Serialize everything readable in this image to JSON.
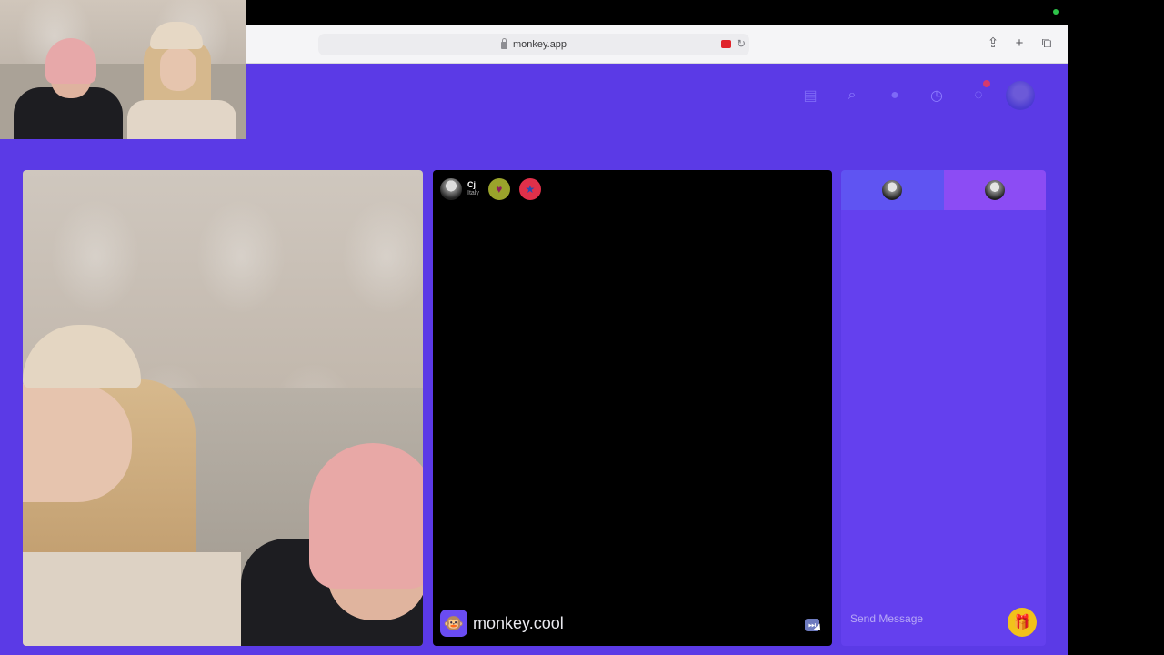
{
  "browser": {
    "url": "monkey.app"
  },
  "header_icons": [
    {
      "name": "shop-icon"
    },
    {
      "name": "search-icon"
    },
    {
      "name": "coin-icon"
    },
    {
      "name": "history-icon"
    },
    {
      "name": "messages-icon"
    },
    {
      "name": "profile-avatar"
    }
  ],
  "peer": {
    "name": "Cj",
    "country": "Italy"
  },
  "brand": {
    "text": "monkey.cool"
  },
  "chat": {
    "placeholder": "Send Message"
  },
  "colors": {
    "app_bg": "#5b3ae6",
    "chat_bg": "#6440ee",
    "tab_active": "#5f54f2",
    "tab_alt": "#8c4cf4",
    "gift": "#f2c21b",
    "recording": "#e0232b"
  }
}
